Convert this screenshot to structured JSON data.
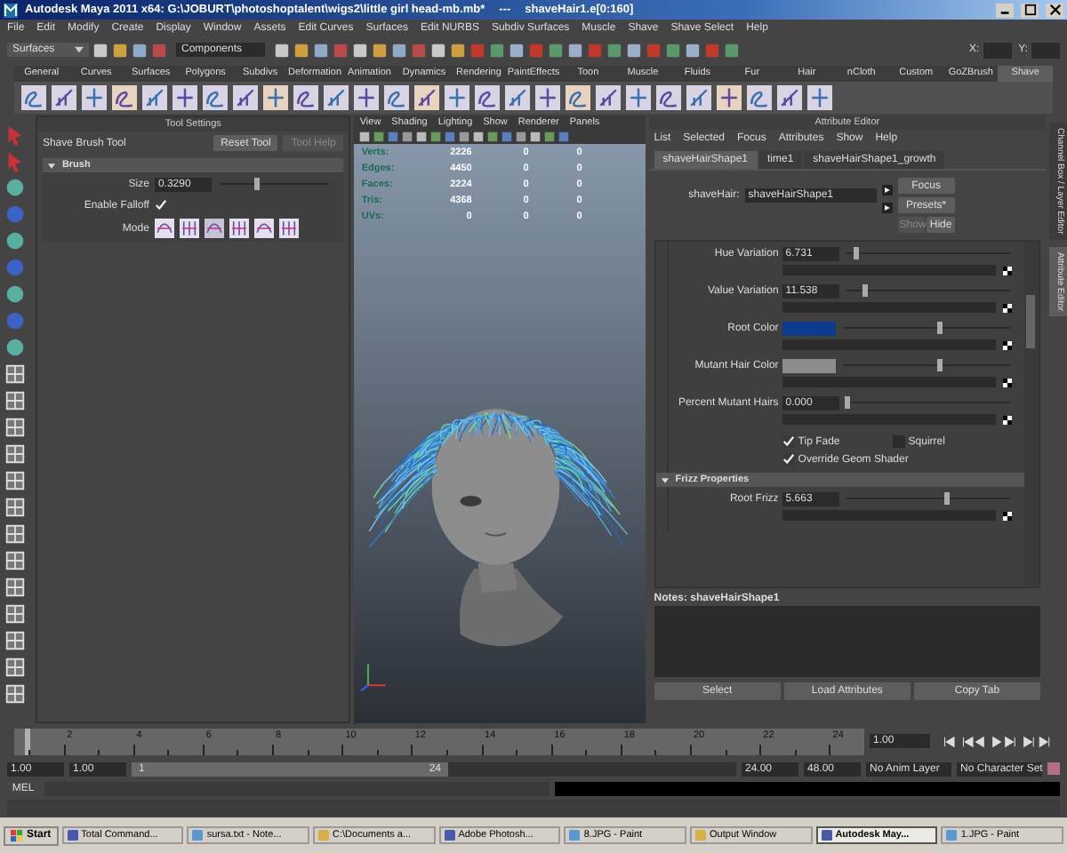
{
  "window": {
    "title": "Autodesk Maya 2011 x64: G:\\JOBURT\\photoshoptalent\\wigs2\\little girl head-mb.mb*",
    "separator": "---",
    "selection": "shaveHair1.e[0:160]"
  },
  "menu": [
    "File",
    "Edit",
    "Modify",
    "Create",
    "Display",
    "Window",
    "Assets",
    "Edit Curves",
    "Surfaces",
    "Edit NURBS",
    "Subdiv Surfaces",
    "Muscle",
    "Shave",
    "Shave Select",
    "Help"
  ],
  "status_line": {
    "mode": "Surfaces",
    "selection_mask": "Components",
    "coord_labels": [
      "X:",
      "Y:"
    ]
  },
  "shelf": {
    "tabs": [
      {
        "label": "General",
        "selected": false
      },
      {
        "label": "Curves",
        "selected": false
      },
      {
        "label": "Surfaces",
        "selected": false
      },
      {
        "label": "Polygons",
        "selected": false
      },
      {
        "label": "Subdivs",
        "selected": false
      },
      {
        "label": "Deformation",
        "selected": false
      },
      {
        "label": "Animation",
        "selected": false
      },
      {
        "label": "Dynamics",
        "selected": false
      },
      {
        "label": "Rendering",
        "selected": false
      },
      {
        "label": "PaintEffects",
        "selected": false
      },
      {
        "label": "Toon",
        "selected": false
      },
      {
        "label": "Muscle",
        "selected": false
      },
      {
        "label": "Fluids",
        "selected": false
      },
      {
        "label": "Fur",
        "selected": false
      },
      {
        "label": "Hair",
        "selected": false
      },
      {
        "label": "nCloth",
        "selected": false
      },
      {
        "label": "Custom",
        "selected": false
      },
      {
        "label": "GoZBrush",
        "selected": false
      },
      {
        "label": "Shave",
        "selected": true
      }
    ]
  },
  "tool_settings": {
    "title": "Tool Settings",
    "tool_name": "Shave Brush Tool",
    "buttons": [
      {
        "label": "Reset Tool",
        "disabled": false
      },
      {
        "label": "Tool Help",
        "disabled": true
      }
    ],
    "section": "Brush",
    "size": {
      "label": "Size",
      "value": "0.3290",
      "level": 0.33
    },
    "falloff": {
      "label": "Enable Falloff",
      "checked": true
    },
    "mode_label": "Mode"
  },
  "viewport": {
    "menu": [
      "View",
      "Shading",
      "Lighting",
      "Show",
      "Renderer",
      "Panels"
    ],
    "hud": [
      {
        "label": "Verts:",
        "values": [
          "2226",
          "0",
          "0"
        ]
      },
      {
        "label": "Edges:",
        "values": [
          "4450",
          "0",
          "0"
        ]
      },
      {
        "label": "Faces:",
        "values": [
          "2224",
          "0",
          "0"
        ]
      },
      {
        "label": "Tris:",
        "values": [
          "4368",
          "0",
          "0"
        ]
      },
      {
        "label": "UVs:",
        "values": [
          "0",
          "0",
          "0"
        ]
      }
    ]
  },
  "attribute_editor": {
    "title": "Attribute Editor",
    "menu": [
      "List",
      "Selected",
      "Focus",
      "Attributes",
      "Show",
      "Help"
    ],
    "tabs": [
      {
        "label": "shaveHairShape1",
        "selected": true
      },
      {
        "label": "time1",
        "selected": false
      },
      {
        "label": "shaveHairShape1_growth",
        "selected": false
      }
    ],
    "node_label": "shaveHair:",
    "node_value": "shaveHairShape1",
    "buttons": [
      {
        "label": "Focus",
        "disabled": false
      },
      {
        "label": "Presets*",
        "disabled": false
      },
      {
        "label": "Show",
        "disabled": true
      },
      {
        "label": "Hide",
        "disabled": false
      }
    ],
    "attributes": [
      {
        "kind": "number",
        "label": "Hue Variation",
        "value": "6.731",
        "level": 0.06
      },
      {
        "kind": "number",
        "label": "Value Variation",
        "value": "11.538",
        "level": 0.11
      },
      {
        "kind": "color",
        "label": "Root Color",
        "color": "#0b3c8e",
        "level": 0.58
      },
      {
        "kind": "color",
        "label": "Mutant Hair Color",
        "color": "#8c8c8c",
        "level": 0.58
      },
      {
        "kind": "number",
        "label": "Percent Mutant Hairs",
        "value": "0.000",
        "level": 0
      }
    ],
    "checkboxes": [
      {
        "label": "Tip Fade",
        "checked": true
      },
      {
        "label": "Squirrel",
        "checked": false
      },
      {
        "label": "Override Geom Shader",
        "checked": true
      }
    ],
    "frizz": {
      "title": "Frizz Properties",
      "attributes": [
        {
          "kind": "number",
          "label": "Root Frizz",
          "value": "5.663",
          "level": 0.61
        }
      ]
    },
    "notes_label": "Notes:  shaveHairShape1",
    "bottom_buttons": [
      "Select",
      "Load Attributes",
      "Copy Tab"
    ]
  },
  "side_tabs": [
    {
      "label": "Channel Box / Layer Editor",
      "selected": false
    },
    {
      "label": "Attribute Editor",
      "selected": true
    }
  ],
  "timeline": {
    "ticks": [
      "2",
      "4",
      "6",
      "8",
      "10",
      "12",
      "14",
      "16",
      "18",
      "20",
      "22",
      "24"
    ],
    "current_frame": "1.00",
    "level": 0
  },
  "range": {
    "start": "1.00",
    "inner_start": "1.00",
    "slider_start": "1",
    "slider_end": "24",
    "inner_end": "24.00",
    "end": "48.00",
    "level": 0.5,
    "anim_layer": "No Anim Layer",
    "character_set": "No Character Set"
  },
  "command_line": {
    "label": "MEL"
  },
  "taskbar": {
    "start": "Start",
    "items": [
      {
        "label": "Total Command...",
        "selected": false
      },
      {
        "label": "sursa.txt - Note...",
        "selected": false
      },
      {
        "label": "C:\\Documents a...",
        "selected": false
      },
      {
        "label": "Adobe Photosh...",
        "selected": false
      },
      {
        "label": "8.JPG - Paint",
        "selected": false
      },
      {
        "label": "Output Window",
        "selected": false
      },
      {
        "label": "Autodesk May...",
        "selected": true
      },
      {
        "label": "1.JPG - Paint",
        "selected": false
      }
    ]
  }
}
